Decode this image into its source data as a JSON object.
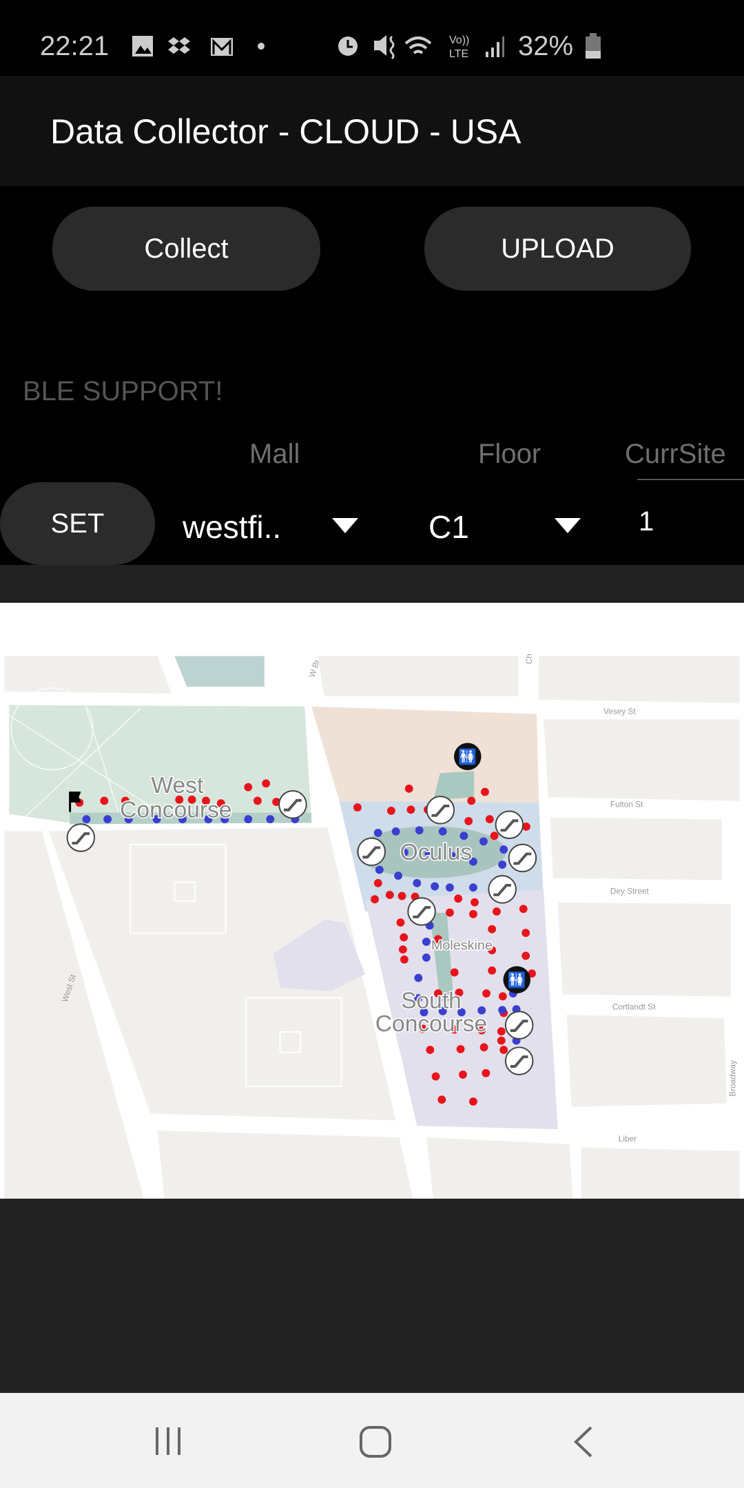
{
  "status_bar": {
    "time": "22:21",
    "battery": "32%",
    "icons": [
      "gallery-icon",
      "dropbox-icon",
      "gmail-icon",
      "dot-icon",
      "alarm-icon",
      "mute-vibrate-icon",
      "wifi-icon",
      "volte-icon",
      "signal-icon",
      "battery-icon"
    ],
    "volte": "Vo)) LTE"
  },
  "app": {
    "title": "Data Collector - CLOUD - USA"
  },
  "buttons": {
    "collect": "Collect",
    "upload": "UPLOAD",
    "set": "SET"
  },
  "ble_status": "BLE SUPPORT!",
  "selectors": {
    "mall_label": "Mall",
    "floor_label": "Floor",
    "currsite_label": "CurrSite",
    "mall_value": "westfi..",
    "floor_value": "C1",
    "currsite_value": "1"
  },
  "map": {
    "areas": {
      "west": "West",
      "west2": "Concourse",
      "oculus": "Oculus",
      "south": "South",
      "south2": "Concourse",
      "store": "Moleskine"
    },
    "streets": {
      "vesey": "Vesey St",
      "fulton": "Fulton St",
      "dey": "Dey Street",
      "cortlandt": "Cortlandt St",
      "liber": "Liber",
      "broadway": "Broadway",
      "west_st": "West St",
      "w_br": "W Br",
      "ch": "Ch"
    },
    "colors": {
      "red_points": "#e8141c",
      "blue_points": "#3a3fd0",
      "west_area": "#d6e6dc",
      "oculus_area": "#cfdcea",
      "south_area": "#e2e0ec",
      "north_area": "#f0e1d6"
    }
  },
  "nav": {
    "recents": "recents-icon",
    "home": "home-icon",
    "back": "back-icon"
  }
}
